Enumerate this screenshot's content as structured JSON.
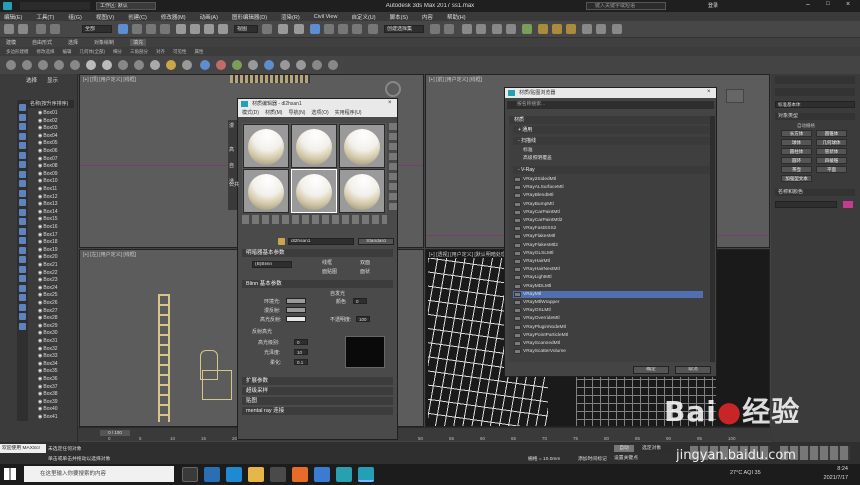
{
  "window": {
    "title": "Autodesk 3ds Max 2017    ss1.max",
    "workspace": "工作区: 默认",
    "search_placeholder": "键入关键字或短语",
    "login": "登录"
  },
  "menu": [
    "编辑(E)",
    "工具(T)",
    "组(G)",
    "视图(V)",
    "创建(C)",
    "修改器(M)",
    "动画(A)",
    "图形编辑器(D)",
    "渲染(R)",
    "Civil View",
    "自定义(U)",
    "脚本(S)",
    "内容",
    "帮助(H)"
  ],
  "toolbar": {
    "selection_dropdown": "全部",
    "view_dropdown": "视图",
    "named_set": "创建选择集"
  },
  "ribbon": {
    "tabs": [
      "建模",
      "自由形式",
      "选择",
      "对象绘制",
      "填充"
    ],
    "sub": [
      "多边形建模",
      "修改选择",
      "编辑",
      "几何体(全部)",
      "细分",
      "三角剖分",
      "对齐",
      "可见性",
      "属性"
    ]
  },
  "scene_explorer": {
    "tabs": [
      "选择",
      "显示"
    ],
    "header": "名称(按升序排序)",
    "items": [
      "Box01",
      "Box02",
      "Box03",
      "Box04",
      "Box05",
      "Box06",
      "Box07",
      "Box08",
      "Box09",
      "Box10",
      "Box11",
      "Box12",
      "Box13",
      "Box14",
      "Box15",
      "Box16",
      "Box17",
      "Box18",
      "Box19",
      "Box20",
      "Box21",
      "Box22",
      "Box23",
      "Box24",
      "Box25",
      "Box26",
      "Box27",
      "Box28",
      "Box29",
      "Box30",
      "Box31",
      "Box32",
      "Box33",
      "Box34",
      "Box35",
      "Box36",
      "Box37",
      "Box38",
      "Box39",
      "Box40",
      "Box41"
    ]
  },
  "viewports": [
    {
      "label": "[+] [顶] [用户定义] [线框]"
    },
    {
      "label": "[+] [前] [用户定义] [线框]"
    },
    {
      "label": "[+] [左] [用户定义] [线框]"
    },
    {
      "label": "[+] [透视] [用户定义] [默认明暗处理]"
    }
  ],
  "material_editor": {
    "title": "材质编辑器 - dl2hsan1",
    "menu": [
      "模式(D)",
      "材质(M)",
      "导航(N)",
      "选项(O)",
      "实用程序(U)"
    ],
    "material_name": "dl2hsan1",
    "material_type": "Standard",
    "rollouts": [
      "明暗器基本参数",
      "Blinn 基本参数",
      "扩展参数",
      "超级采样",
      "贴图",
      "mental ray 连接"
    ],
    "shader": "(B)Blinn",
    "shader_options": [
      "线框",
      "双面",
      "面贴图",
      "面状"
    ],
    "self_illum": "自发光",
    "color_label": "颜色",
    "ambient": "环境光:",
    "diffuse": "漫反射:",
    "specular": "高光反射:",
    "opacity": "不透明度:",
    "opacity_value": "100",
    "spec_highlights": "反射高光",
    "specular_level": "高光级别:",
    "specular_level_value": "0",
    "glossiness": "光泽度:",
    "glossiness_value": "10",
    "soften": "柔化:",
    "soften_value": "0.1",
    "self_illum_value": "0",
    "side_letters": [
      "漫",
      "高",
      "自",
      "透"
    ],
    "status_label": "公共"
  },
  "material_browser": {
    "title": "材质/贴图浏览器",
    "search_placeholder": "按名称搜索...",
    "groups": [
      "材质",
      "+ 通用",
      "- 扫描线",
      "- V-Ray"
    ],
    "scanline": [
      "标准",
      "高级照明覆盖"
    ],
    "vray": [
      "VRay2SidedMtl",
      "VRayALSurfaceMtl",
      "VRayBlendMtl",
      "VRayBumpMtl",
      "VRayCarPaintMtl",
      "VRayCarPaintMtl2",
      "VRayFastSSS2",
      "VRayFlakesMtl",
      "VRayFlakesMtl2",
      "VRayGLSLMtl",
      "VRayHairMtl",
      "VRayHairNextMtl",
      "VRayLightMtl",
      "VRayMDLMtl",
      "VRayMtl",
      "VRayMtlWrapper",
      "VRayOSLMtl",
      "VRayOverrideMtl",
      "VRayPluginNodeMtl",
      "VRayPointParticleMtl",
      "VRayScannedMtl",
      "VRayScatterVolume"
    ],
    "selected": "VRayMtl",
    "ok": "确定",
    "cancel": "取消"
  },
  "command_panel": {
    "object_name": "标准基本体",
    "rollout_object_type": "对象类型",
    "autogrid": "自动栅格",
    "buttons": [
      "长方体",
      "圆锥体",
      "球体",
      "几何球体",
      "圆柱体",
      "管状体",
      "圆环",
      "四棱锥",
      "茶壶",
      "平面",
      "加强型文本"
    ],
    "rollout_name_color": "名称和颜色"
  },
  "timeline": {
    "frame": "0 / 100",
    "ticks": [
      "0",
      "5",
      "10",
      "15",
      "20",
      "25",
      "30",
      "35",
      "40",
      "45",
      "50",
      "55",
      "60",
      "65",
      "70",
      "75",
      "80",
      "85",
      "90",
      "95",
      "100"
    ]
  },
  "status": {
    "prompt": "未选定任何对象",
    "hint": "单击或单击并拖动以选择对象",
    "welcome": "欢迎使用 MAXScr",
    "grid": "栅格 = 10.0mm",
    "add_time_tag": "添加时间标记",
    "auto": "自动",
    "set_key": "设置关键点",
    "selected": "选定对象"
  },
  "taskbar": {
    "search_placeholder": "在这里输入你要搜索的内容",
    "weather": "27°C  AQI 35",
    "time": "8:24",
    "date": "2021/7/17"
  },
  "watermark": {
    "site": "jingyan.baidu.com"
  }
}
